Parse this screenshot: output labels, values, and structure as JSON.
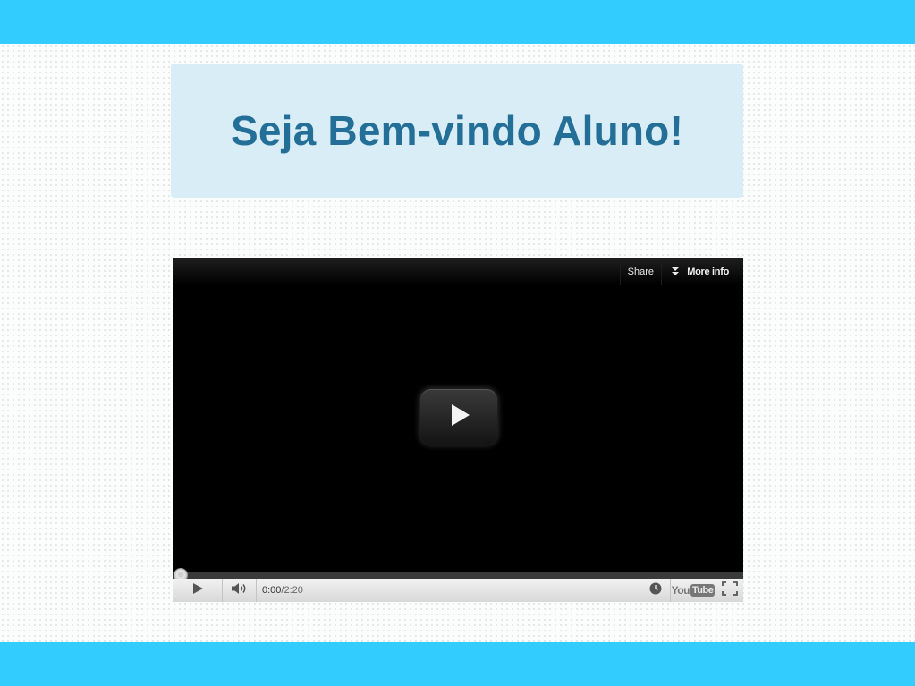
{
  "page": {
    "welcome_title": "Seja Bem-vindo Aluno!",
    "header_color": "#33ccff",
    "panel_color": "#d9edf7",
    "title_color": "#236f98"
  },
  "video_player": {
    "share_label": "Share",
    "more_info_label": "More info",
    "current_time": "0:00",
    "time_separator": " / ",
    "duration": "2:20",
    "youtube_logo": {
      "you": "You",
      "tube": "Tube"
    },
    "progress": 0,
    "icons": {
      "big_play": "play-icon",
      "more_info": "double-chevron-down-icon",
      "play": "play-icon",
      "volume": "speaker-icon",
      "watch_later": "clock-icon",
      "fullscreen": "fullscreen-icon"
    }
  }
}
